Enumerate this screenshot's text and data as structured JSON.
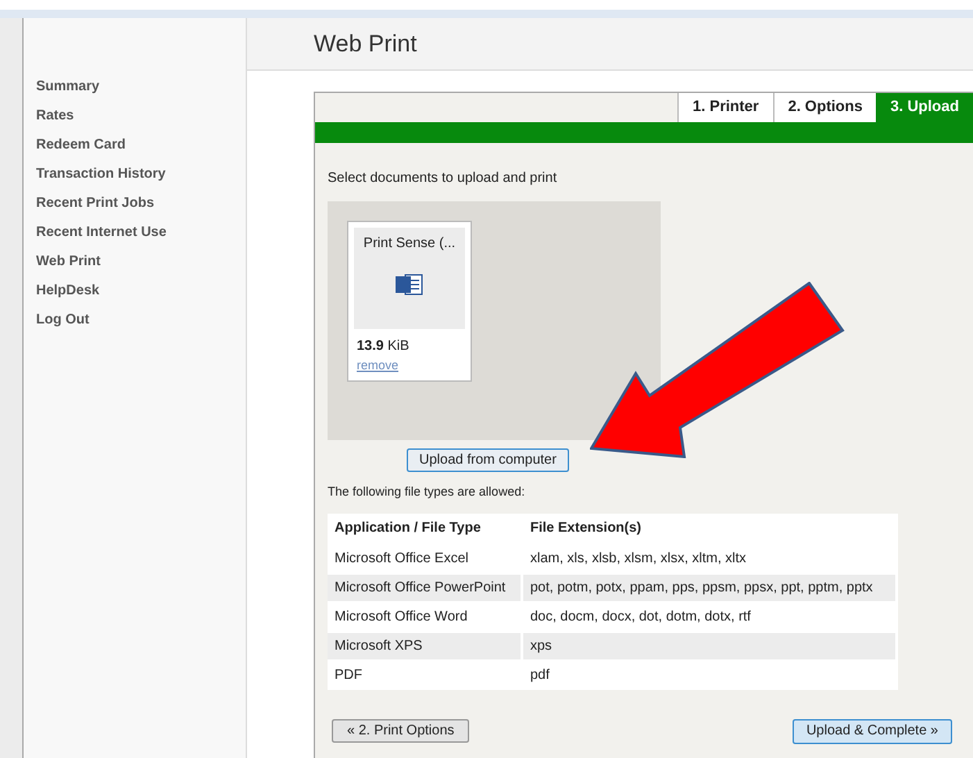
{
  "sidebar": {
    "items": [
      {
        "label": "Summary"
      },
      {
        "label": "Rates"
      },
      {
        "label": "Redeem Card"
      },
      {
        "label": "Transaction History"
      },
      {
        "label": "Recent Print Jobs"
      },
      {
        "label": "Recent Internet Use"
      },
      {
        "label": "Web Print"
      },
      {
        "label": "HelpDesk"
      },
      {
        "label": "Log Out"
      }
    ]
  },
  "page_title": "Web Print",
  "steps": [
    {
      "label": "1. Printer",
      "selected": false
    },
    {
      "label": "2. Options",
      "selected": false
    },
    {
      "label": "3. Upload",
      "selected": true
    }
  ],
  "instruction": "Select documents to upload and print",
  "files": [
    {
      "name": "Print Sense (...",
      "size_value": "13.9",
      "size_unit": "KiB",
      "remove": "remove"
    }
  ],
  "upload_button": "Upload from computer",
  "allowed_text": "The following file types are allowed:",
  "table": {
    "columns": [
      "Application / File Type",
      "File Extension(s)"
    ],
    "rows": [
      [
        "Microsoft Office Excel",
        "xlam, xls, xlsb, xlsm, xlsx, xltm, xltx"
      ],
      [
        "Microsoft Office PowerPoint",
        "pot, potm, potx, ppam, pps, ppsm, ppsx, ppt, pptm, pptx"
      ],
      [
        "Microsoft Office Word",
        "doc, docm, docx, dot, dotm, dotx, rtf"
      ],
      [
        "Microsoft XPS",
        "xps"
      ],
      [
        "PDF",
        "pdf"
      ]
    ]
  },
  "back_button": "« 2. Print Options",
  "next_button": "Upload & Complete »"
}
